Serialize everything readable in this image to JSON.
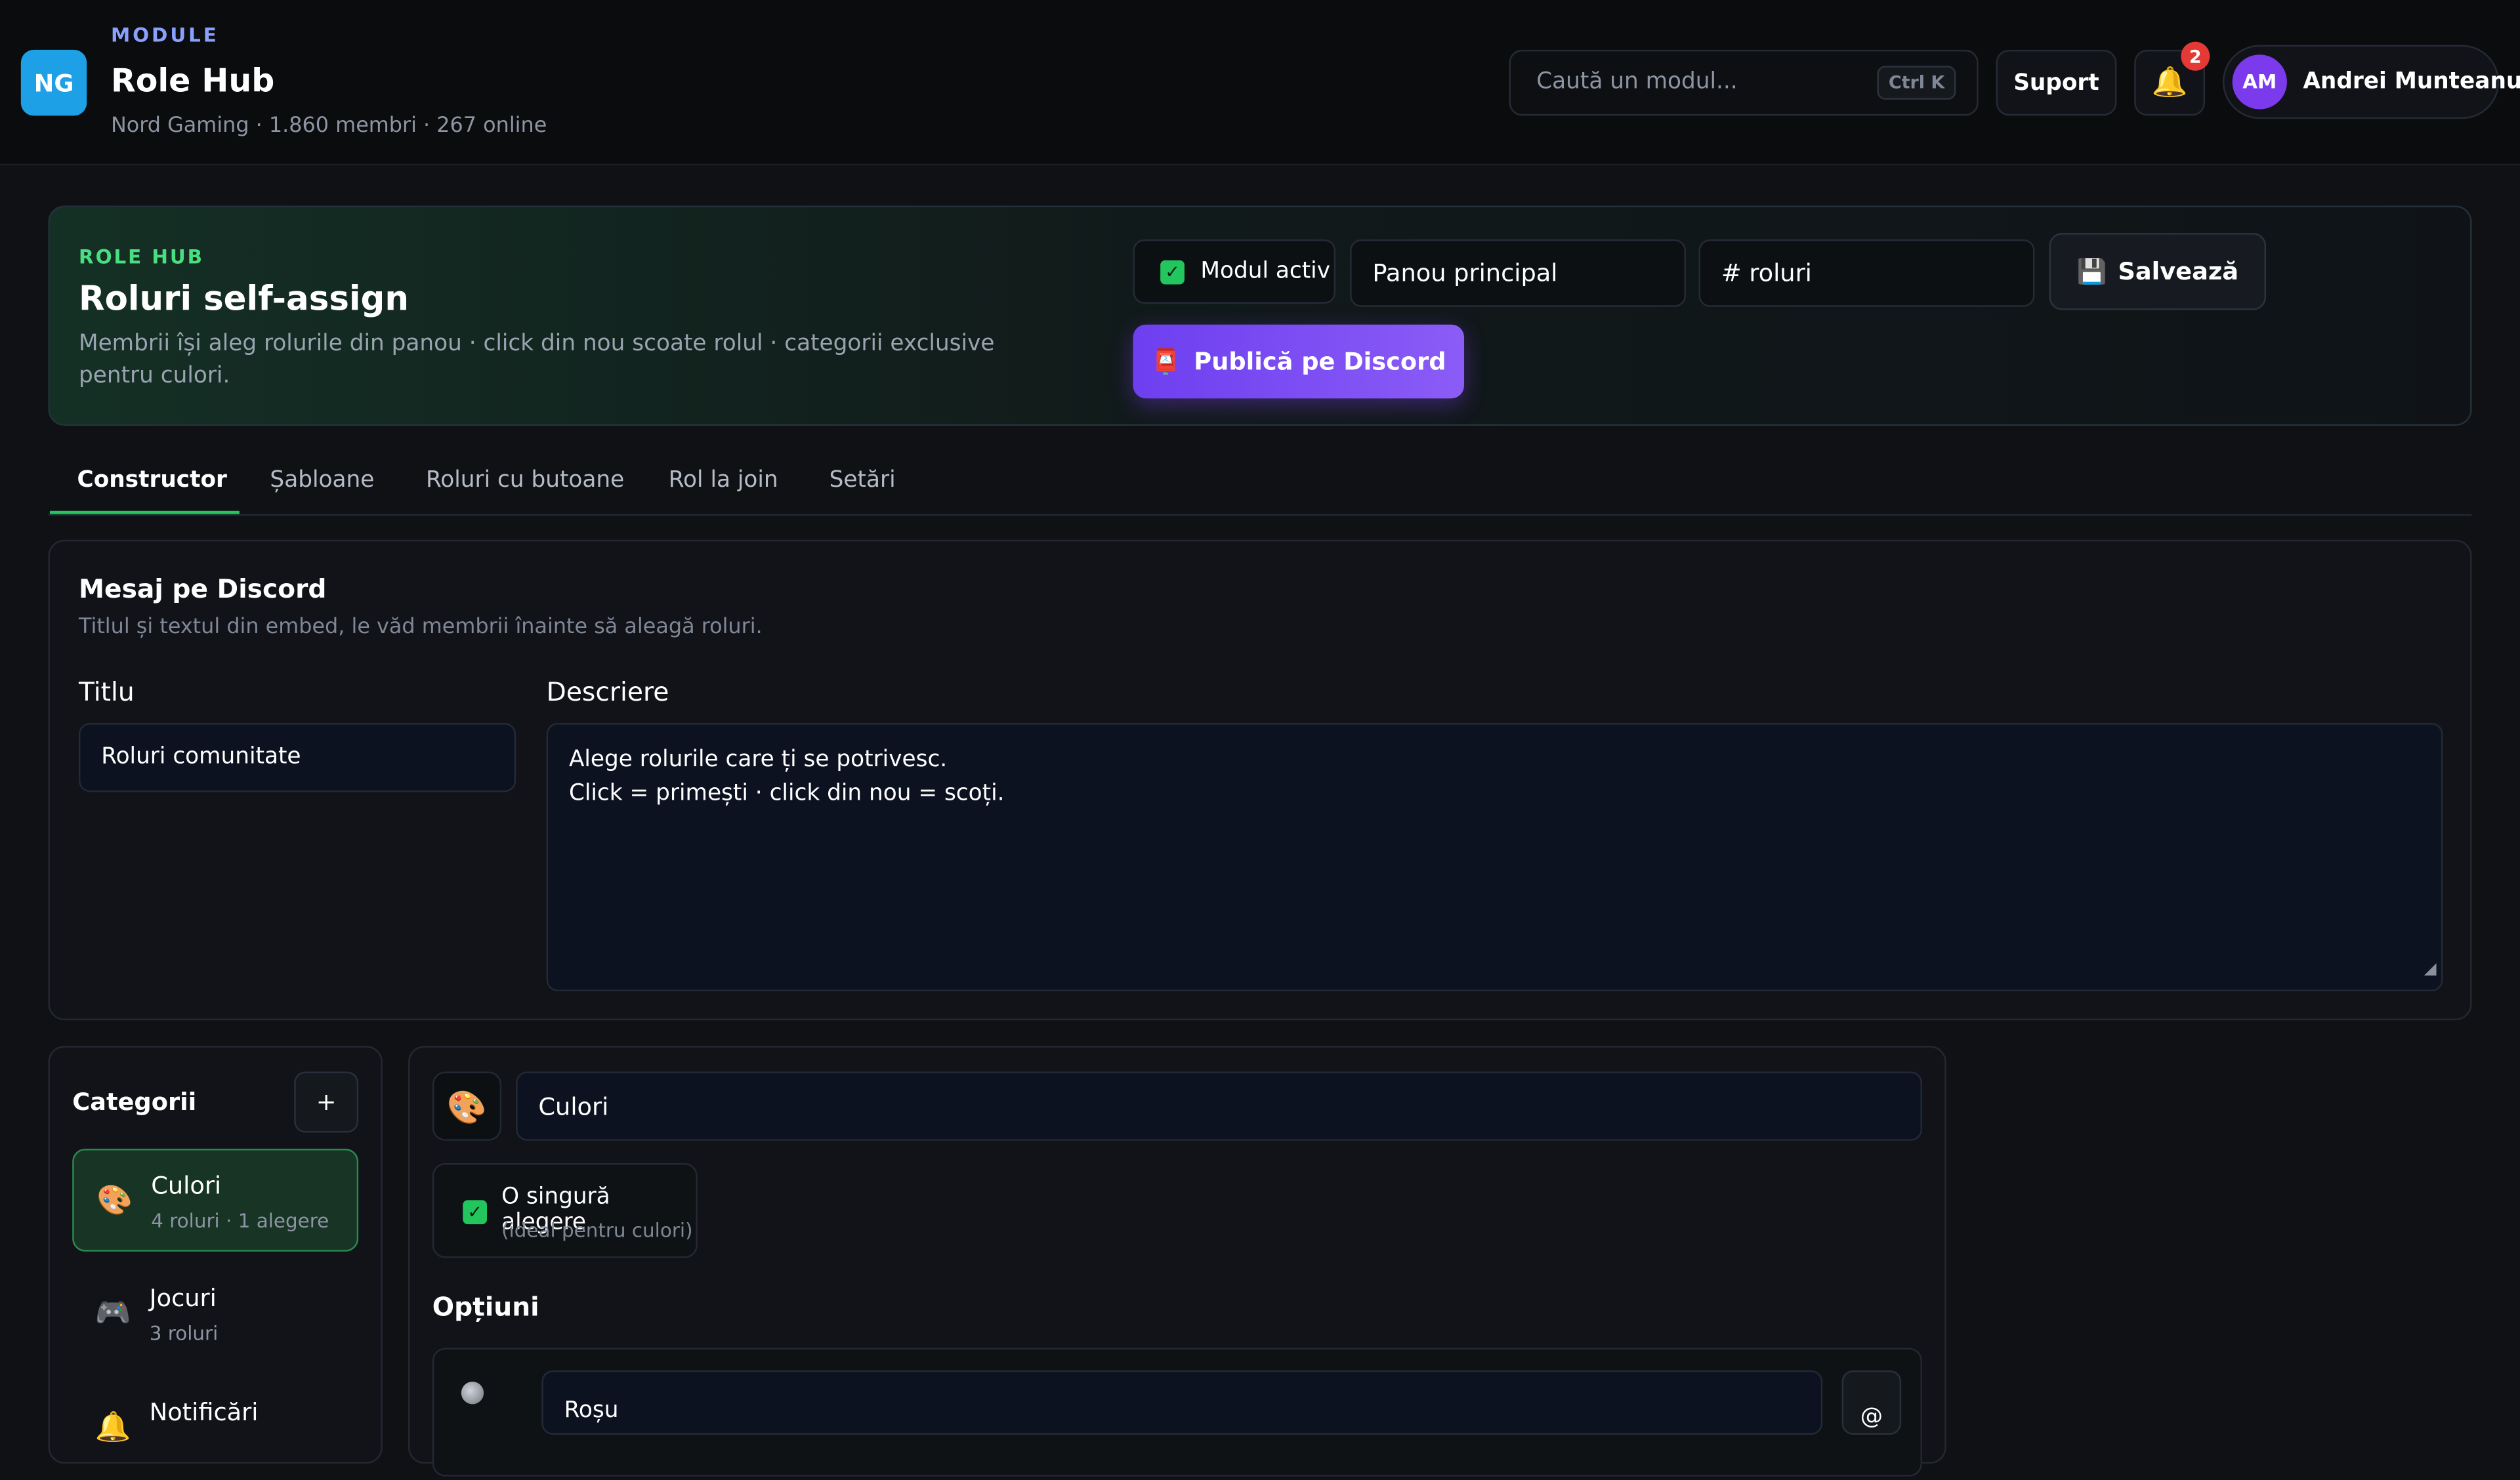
{
  "header": {
    "logo_text": "NG",
    "eyebrow": "MODULE",
    "title": "Role Hub",
    "subtitle": "Nord Gaming · 1.860 membri · 267 online",
    "search_placeholder": "Caută un modul...",
    "search_shortcut": "Ctrl K",
    "support_label": "Suport",
    "notification_count": "2",
    "user_initials": "AM",
    "user_name": "Andrei Munteanu"
  },
  "hero": {
    "eyebrow": "ROLE HUB",
    "title": "Roluri self-assign",
    "description": "Membrii își aleg rolurile din panou · click din nou scoate rolul · categorii exclusive pentru culori.",
    "active_label": "Modul activ",
    "panel_select": "Panou principal",
    "channel_select": "# roluri",
    "save_label": "Salvează",
    "publish_label": "Publică pe Discord"
  },
  "tabs": [
    "Constructor",
    "Șabloane",
    "Roluri cu butoane",
    "Rol la join",
    "Setări"
  ],
  "message": {
    "title": "Mesaj pe Discord",
    "subtitle": "Titlul și textul din embed, le văd membrii înainte să aleagă roluri.",
    "title_label": "Titlu",
    "title_value": "Roluri comunitate",
    "desc_label": "Descriere",
    "desc_value": "Alege rolurile care ți se potrivesc.\nClick = primești · click din nou = scoți."
  },
  "categories": {
    "heading": "Categorii",
    "add_label": "+",
    "items": [
      {
        "icon": "🎨",
        "name": "Culori",
        "meta": "4 roluri · 1 alegere"
      },
      {
        "icon": "🎮",
        "name": "Jocuri",
        "meta": "3 roluri"
      },
      {
        "icon": "🔔",
        "name": "Notificări",
        "meta": ""
      }
    ]
  },
  "editor": {
    "emoji": "🎨",
    "category_name": "Culori",
    "single_choice_label": "O singură alegere",
    "single_choice_hint": "(ideal pentru culori)",
    "options_heading": "Opțiuni",
    "options": [
      {
        "name": "Roșu",
        "mention": "@"
      }
    ]
  },
  "colors": {
    "accent_green": "#22c55e",
    "publish_purple": "#7c3aed",
    "logo_blue": "#1ea0e6",
    "badge_red": "#e53935"
  }
}
